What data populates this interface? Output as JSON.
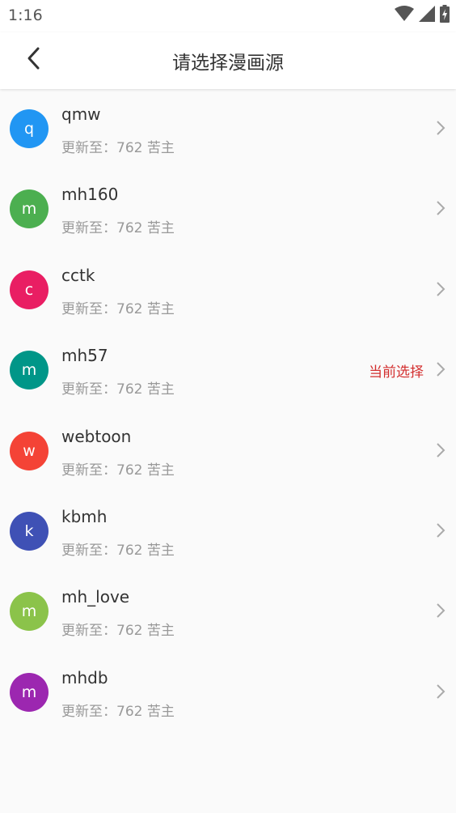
{
  "status_bar": {
    "time": "1:16",
    "icons": [
      "wifi-icon",
      "signal-icon",
      "battery-icon"
    ]
  },
  "app_bar": {
    "back_icon": "back-arrow-icon",
    "title": "请选择漫画源"
  },
  "sources": [
    {
      "name": "qmw",
      "initial": "q",
      "color": "#2196f3",
      "subtitle": "更新至：762 苦主",
      "tag": ""
    },
    {
      "name": "mh160",
      "initial": "m",
      "color": "#4caf50",
      "subtitle": "更新至：762 苦主",
      "tag": ""
    },
    {
      "name": "cctk",
      "initial": "c",
      "color": "#e91e63",
      "subtitle": "更新至：762 苦主",
      "tag": ""
    },
    {
      "name": "mh57",
      "initial": "m",
      "color": "#009688",
      "subtitle": "更新至：762 苦主",
      "tag": "当前选择"
    },
    {
      "name": "webtoon",
      "initial": "w",
      "color": "#f44336",
      "subtitle": "更新至：762 苦主",
      "tag": ""
    },
    {
      "name": "kbmh",
      "initial": "k",
      "color": "#3f51b5",
      "subtitle": "更新至：762 苦主",
      "tag": ""
    },
    {
      "name": "mh_love",
      "initial": "m",
      "color": "#8bc34a",
      "subtitle": "更新至：762 苦主",
      "tag": ""
    },
    {
      "name": "mhdb",
      "initial": "m",
      "color": "#9c27b0",
      "subtitle": "更新至：762 苦主",
      "tag": ""
    }
  ],
  "colors": {
    "accent_tag": "#d32f2f",
    "subtitle": "#999999",
    "background": "#fafafa"
  }
}
